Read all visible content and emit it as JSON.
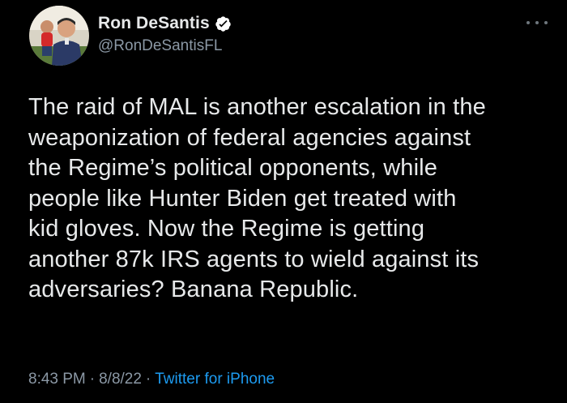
{
  "user": {
    "display_name": "Ron DeSantis",
    "handle": "@RonDeSantisFL",
    "avatar_icon": "profile-photo",
    "verified_icon": "verified-badge-icon",
    "verified_color": "#ffffff"
  },
  "menu": {
    "more_icon": "more-options-icon"
  },
  "tweet": {
    "text": "The raid of MAL is another escalation in the\nweaponization of federal agencies against\nthe Regime’s political opponents, while\npeople like Hunter Biden get treated with\nkid gloves. Now the Regime is getting\nanother 87k IRS agents to wield against its\nadversaries? Banana Republic."
  },
  "meta": {
    "time": "8:43 PM",
    "separator": "·",
    "date": "8/8/22",
    "source": "Twitter for iPhone"
  },
  "colors": {
    "background": "#000000",
    "text_primary": "#e7e9ea",
    "text_secondary": "#8b98a5",
    "link": "#1d9bf0"
  }
}
